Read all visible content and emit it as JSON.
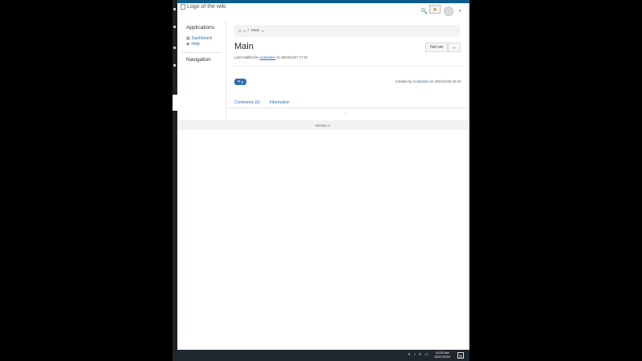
{
  "header": {
    "logo_alt": "Logo of the wiki",
    "search_icon": "search-icon",
    "notification_icon": "send-icon",
    "user_caret": "▾"
  },
  "sidebar": {
    "applications_title": "Applications",
    "items": [
      {
        "label": "Dashboard",
        "icon": "dashboard-icon"
      },
      {
        "label": "Help",
        "icon": "help-icon"
      }
    ],
    "navigation_title": "Navigation"
  },
  "breadcrumb": {
    "home_icon": "home-icon",
    "separator": "/",
    "current": "Main"
  },
  "page": {
    "title": "Main",
    "modified_prefix": "Last modified by",
    "modified_user": "localadmin",
    "modified_suffix": "on 2024/12/27 17:21",
    "rating_button": "Not set",
    "like_count": "0",
    "created_prefix": "Created by",
    "created_user": "localadmin",
    "created_suffix": "on 2024/12/19 22:16"
  },
  "tabs": [
    {
      "label": "Comments (0)"
    },
    {
      "label": "Information"
    }
  ],
  "footer": {
    "version": "Version 1"
  },
  "taskbar": {
    "time": "10:25 AM",
    "date": "12/27/2024"
  }
}
